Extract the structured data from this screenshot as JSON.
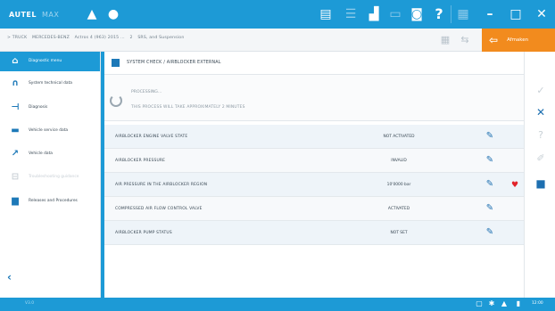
{
  "app": {
    "logo": "AUTEL",
    "logo_sub": "MAX"
  },
  "titlebar": {
    "icons": [
      "warning-icon",
      "help-circle-icon",
      "report-icon",
      "list-icon",
      "car-icon",
      "battery-icon",
      "camera-icon",
      "help-icon",
      "menu-icon"
    ],
    "window_controls": [
      "minimize",
      "maximize",
      "close"
    ]
  },
  "breadcrumb": {
    "items": [
      "> TRUCK",
      "MERCEDES-BENZ",
      "Actros 4 (963) 2015 ...",
      "2",
      "SRS, and Suspension"
    ],
    "back_label": "Afmaken"
  },
  "sidebar": {
    "items": [
      {
        "label": "Diagnostic menu",
        "icon": "home-icon",
        "active": true,
        "disabled": false
      },
      {
        "label": "System technical data",
        "icon": "headset-icon",
        "active": false,
        "disabled": false
      },
      {
        "label": "Diagnosis",
        "icon": "signal-icon",
        "active": false,
        "disabled": false
      },
      {
        "label": "Vehicle service data",
        "icon": "car-side-icon",
        "active": false,
        "disabled": false
      },
      {
        "label": "Vehicle data",
        "icon": "wrench-icon",
        "active": false,
        "disabled": false
      },
      {
        "label": "Troubleshooting guidance",
        "icon": "guide-icon",
        "active": false,
        "disabled": true
      },
      {
        "label": "Releases and Procedures",
        "icon": "document-icon",
        "active": false,
        "disabled": false
      }
    ]
  },
  "panel": {
    "title": "SYSTEM CHECK / AIRBLOCKER EXTERNAL",
    "processing_title": "PROCESSING...",
    "processing_sub": "THIS PROCESS WILL TAKE APPROXIMATELY 2 MINUTES"
  },
  "table": {
    "rows": [
      {
        "name": "AIRBLOCKER ENGINE VALVE STATE",
        "value": "NOT ACTIVATED",
        "fav": false
      },
      {
        "name": "AIRBLOCKER PRESSURE",
        "value": "INVALID",
        "fav": false
      },
      {
        "name": "AIR PRESSURE IN THE AIRBLOCKER REGION",
        "value": "10'0000 bar",
        "fav": true
      },
      {
        "name": "COMPRESSED AIR FLOW CONTROL VALVE",
        "value": "ACTIVATED",
        "fav": false
      },
      {
        "name": "AIRBLOCKER PUMP STATUS",
        "value": "NOT SET",
        "fav": false
      }
    ]
  },
  "actions": [
    "check-icon",
    "close-icon",
    "question-icon",
    "edit-note-icon",
    "stop-icon"
  ],
  "status": {
    "version": "V3.0",
    "time": "12:00"
  },
  "colors": {
    "primary": "#1d9ad6",
    "accent": "#f28b1e",
    "favorite": "#e2232a"
  }
}
